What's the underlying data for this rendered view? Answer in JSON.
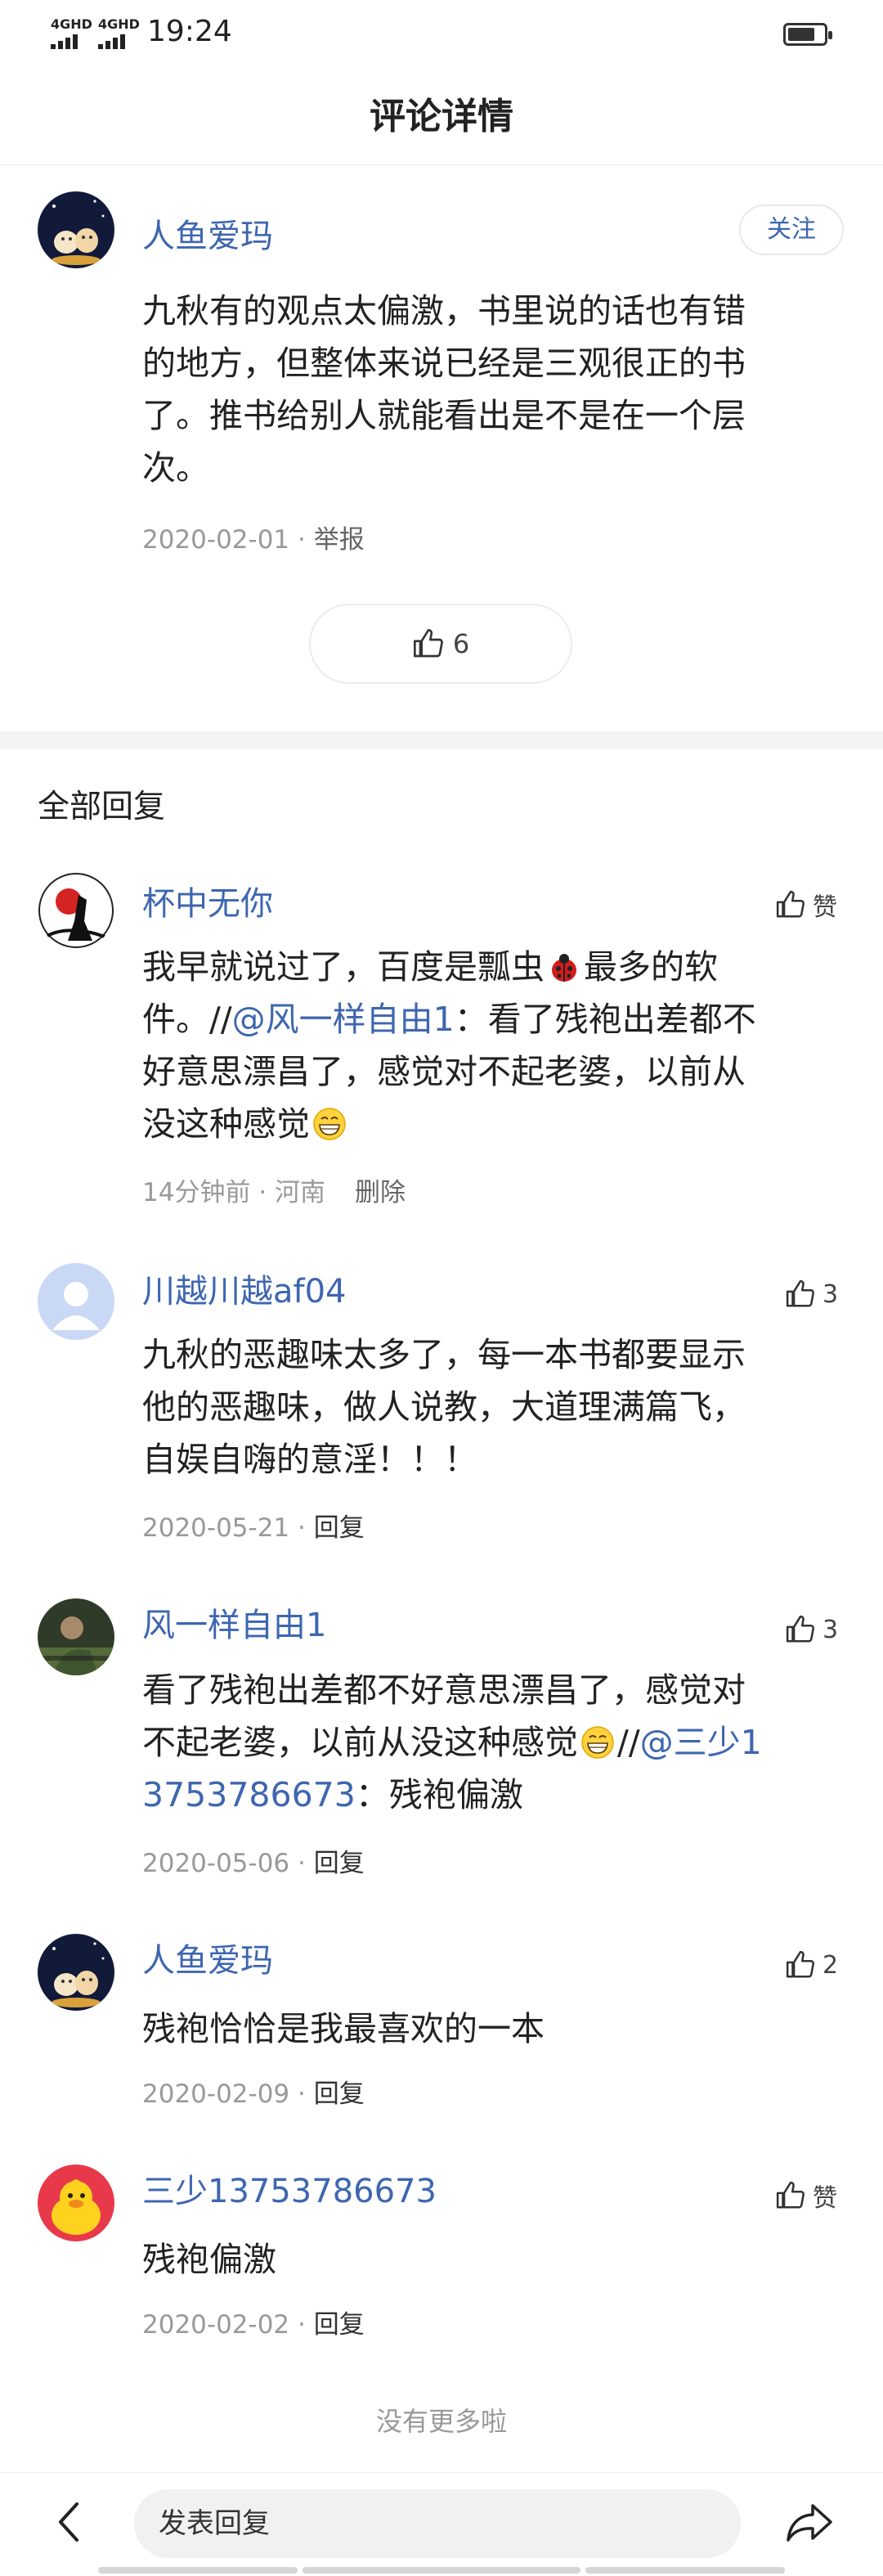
{
  "status": {
    "signal1": "4GHD",
    "signal2": "4GHD",
    "time": "19:24",
    "battery_level": 0.75
  },
  "header": {
    "title": "评论详情"
  },
  "comment": {
    "username": "人鱼爱玛",
    "follow_label": "关注",
    "lines": [
      "九秋有的观点太偏激，书里说的话也有错",
      "的地方，但整体来说已经是三观很正的书",
      "了。推书给别人就能看出是不是在一个层",
      "次。"
    ],
    "date": "2020-02-01",
    "sep": " · ",
    "report_label": "举报",
    "likes": "6"
  },
  "replies_header": "全部回复",
  "replies": [
    {
      "username": "杯中无你",
      "like_label": "赞",
      "line1a": "我早就说过了，百度是瓢虫",
      "line1b": "最多的软",
      "line2a": "件。//",
      "mention": "@风一样自由1",
      "line2b": "：看了残袍出差都不",
      "line3": "好意思漂昌了，感觉对不起老婆，以前从",
      "line4": "没这种感觉",
      "time": "14分钟前",
      "sep": " · ",
      "location": "河南",
      "delete_label": "删除"
    },
    {
      "username": "川越川越af04",
      "like_count": "3",
      "lines": [
        "九秋的恶趣味太多了，每一本书都要显示",
        "他的恶趣味，做人说教，大道理满篇飞，",
        "自娱自嗨的意淫！！！"
      ],
      "date": "2020-05-21",
      "sep": " · ",
      "reply_label": "回复"
    },
    {
      "username": "风一样自由1",
      "like_count": "3",
      "line1": "看了残袍出差都不好意思漂昌了，感觉对",
      "line2a": "不起老婆，以前从没这种感觉",
      "line2b": "//",
      "mention_a": "@三少1",
      "mention_b": "3753786673",
      "line3b": "：残袍偏激",
      "date": "2020-05-06",
      "sep": " · ",
      "reply_label": "回复"
    },
    {
      "username": "人鱼爱玛",
      "like_count": "2",
      "text": "残袍恰恰是我最喜欢的一本",
      "date": "2020-02-09",
      "sep": " · ",
      "reply_label": "回复"
    },
    {
      "username": "三少13753786673",
      "like_label": "赞",
      "text": "残袍偏激",
      "date": "2020-02-02",
      "sep": " · ",
      "reply_label": "回复"
    }
  ],
  "footer": {
    "no_more": "没有更多啦",
    "input_placeholder": "发表回复"
  },
  "icons": {
    "back": "back-arrow-icon",
    "share": "share-arrow-icon",
    "like": "thumbs-up-icon"
  },
  "colors": {
    "link": "#3e66b0",
    "muted": "#999999",
    "separator": "#f4f4f4"
  }
}
